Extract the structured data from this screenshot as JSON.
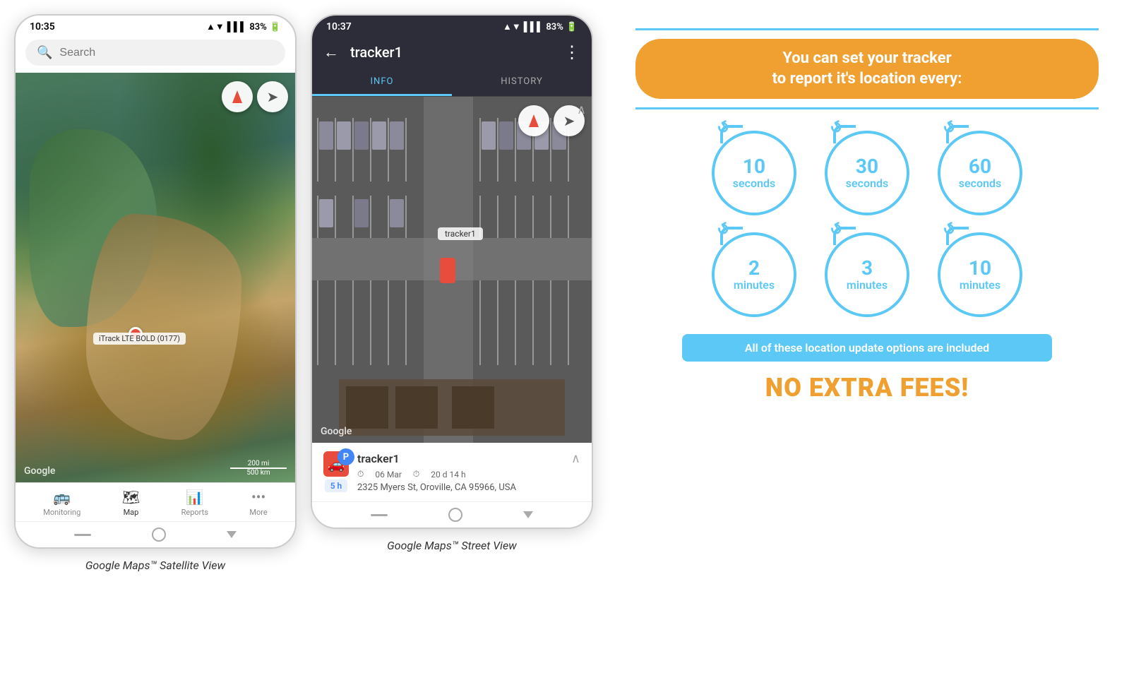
{
  "phone1": {
    "status_bar": {
      "time": "10:35",
      "signal": "▲▼",
      "bars": "▌▌▌",
      "battery": "83%",
      "battery_icon": "🔋"
    },
    "search": {
      "placeholder": "Search"
    },
    "map": {
      "compass_label": "compass",
      "location_label": "location",
      "watermark": "Google",
      "scale_top": "200 mi",
      "scale_bottom": "500 km",
      "tracker_label": "iTrack LTE BOLD (0177)"
    },
    "nav": {
      "items": [
        {
          "icon": "🚌",
          "label": "Monitoring"
        },
        {
          "icon": "🗺",
          "label": "Map"
        },
        {
          "icon": "📊",
          "label": "Reports"
        },
        {
          "icon": "•••",
          "label": "More"
        }
      ],
      "active": "Map"
    }
  },
  "phone2": {
    "status_bar": {
      "time": "10:37",
      "signal": "▲▼",
      "bars": "▌▌▌",
      "battery": "83%"
    },
    "header": {
      "back_icon": "←",
      "title": "tracker1",
      "menu_icon": "⋮"
    },
    "tabs": [
      {
        "label": "INFO",
        "active": true
      },
      {
        "label": "HISTORY",
        "active": false
      }
    ],
    "map": {
      "watermark": "Google",
      "tracker_label": "tracker1",
      "compass_label": "compass",
      "location_label": "location"
    },
    "tracker_info": {
      "name": "tracker1",
      "date": "06 Mar",
      "duration": "20 d 14 h",
      "address": "2325 Myers St, Oroville, CA 95966, USA",
      "time_badge": "5 h",
      "parking_icon": "P"
    }
  },
  "info_panel": {
    "header_line_color": "#5bc8f5",
    "title_line1": "You can set your tracker",
    "title_line2": "to report it's location every:",
    "title_bg_color": "#f0a030",
    "intervals_row1": [
      {
        "number": "10",
        "unit": "seconds"
      },
      {
        "number": "30",
        "unit": "seconds"
      },
      {
        "number": "60",
        "unit": "seconds"
      }
    ],
    "intervals_row2": [
      {
        "number": "2",
        "unit": "minutes"
      },
      {
        "number": "3",
        "unit": "minutes"
      },
      {
        "number": "10",
        "unit": "minutes"
      }
    ],
    "no_fees_text": "All of these location update options are included",
    "no_extra_fees": "NO EXTRA FEES!"
  },
  "captions": {
    "phone1": "Google Maps™ Satellite View",
    "phone2": "Google Maps™ Street View"
  }
}
